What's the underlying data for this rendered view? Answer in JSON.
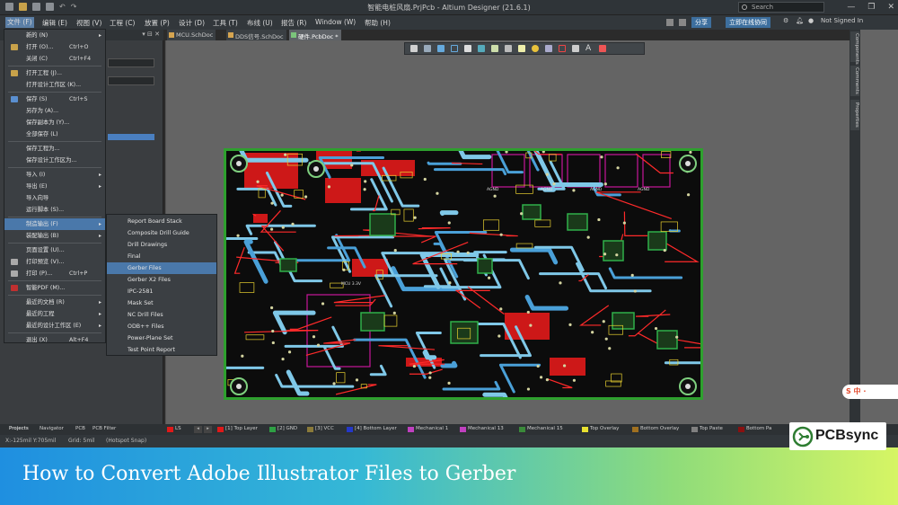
{
  "titlebar": {
    "title": "智能电桩风扇.PrjPcb - Altium Designer (21.6.1)",
    "search_placeholder": "Search",
    "win_buttons": [
      "—",
      "❐",
      "✕"
    ]
  },
  "menubar": {
    "items": [
      "文件 (F)",
      "编辑 (E)",
      "视图 (V)",
      "工程 (C)",
      "放置 (P)",
      "设计 (D)",
      "工具 (T)",
      "布线 (U)",
      "报告 (R)",
      "Window (W)",
      "帮助 (H)"
    ],
    "share_label": "分享",
    "online_label": "立即在线协同",
    "signed_label": "Not Signed In"
  },
  "doc_tabs": [
    "MCU.SchDoc",
    "DDS信号.SchDoc",
    "硬件.PcbDoc *"
  ],
  "file_menu": {
    "items": [
      {
        "label": "新的 (N)",
        "shortcut": "",
        "arrow": "▸"
      },
      {
        "label": "打开 (O)...",
        "shortcut": "Ctrl+O",
        "arrow": ""
      },
      {
        "label": "关闭 (C)",
        "shortcut": "Ctrl+F4",
        "arrow": ""
      },
      {
        "label": "打开工程 (J)...",
        "shortcut": "",
        "arrow": ""
      },
      {
        "label": "打开设计工作区 (K)...",
        "shortcut": "",
        "arrow": ""
      },
      {
        "label": "保存 (S)",
        "shortcut": "Ctrl+S",
        "arrow": ""
      },
      {
        "label": "另存为 (A)...",
        "shortcut": "",
        "arrow": ""
      },
      {
        "label": "保存副本为 (Y)...",
        "shortcut": "",
        "arrow": ""
      },
      {
        "label": "全部保存 (L)",
        "shortcut": "",
        "arrow": ""
      },
      {
        "label": "保存工程为...",
        "shortcut": "",
        "arrow": ""
      },
      {
        "label": "保存设计工作区为...",
        "shortcut": "",
        "arrow": ""
      },
      {
        "label": "导入 (I)",
        "shortcut": "",
        "arrow": "▸"
      },
      {
        "label": "导出 (E)",
        "shortcut": "",
        "arrow": "▸"
      },
      {
        "label": "导入向导",
        "shortcut": "",
        "arrow": ""
      },
      {
        "label": "运行脚本 (S)...",
        "shortcut": "",
        "arrow": ""
      },
      {
        "label": "制造输出 (F)",
        "shortcut": "",
        "arrow": "▸"
      },
      {
        "label": "装配输出 (B)",
        "shortcut": "",
        "arrow": "▸"
      },
      {
        "label": "页面设置 (U)...",
        "shortcut": "",
        "arrow": ""
      },
      {
        "label": "打印预览 (V)...",
        "shortcut": "",
        "arrow": ""
      },
      {
        "label": "打印 (P)...",
        "shortcut": "Ctrl+P",
        "arrow": ""
      },
      {
        "label": "智能PDF (M)...",
        "shortcut": "",
        "arrow": ""
      },
      {
        "label": "最近的文档 (R)",
        "shortcut": "",
        "arrow": "▸"
      },
      {
        "label": "最近的工程",
        "shortcut": "",
        "arrow": "▸"
      },
      {
        "label": "最近的设计工作区 (E)",
        "shortcut": "",
        "arrow": "▸"
      },
      {
        "label": "退出 (X)",
        "shortcut": "Alt+F4",
        "arrow": ""
      }
    ]
  },
  "fab_submenu": {
    "items": [
      "Report Board Stack",
      "Composite Drill Guide",
      "Drill Drawings",
      "Final",
      "Gerber Files",
      "Gerber X2 Files",
      "IPC-2581",
      "Mask Set",
      "NC Drill Files",
      "ODB++ Files",
      "Power-Plane Set",
      "Test Point Report"
    ],
    "highlighted": "Gerber Files"
  },
  "right_panels": [
    "Components",
    "Comments",
    "Properties"
  ],
  "pcb": {
    "net_labels": [
      "AGND",
      "AGND",
      "AGND",
      "AGND",
      "MCU 3.3V"
    ]
  },
  "panel_tabs": [
    "Projects",
    "Navigator",
    "PCB",
    "PCB Filter"
  ],
  "layers": [
    {
      "name": "LS",
      "color": "#e01818"
    },
    {
      "name": "[1] Top Layer",
      "color": "#e01818"
    },
    {
      "name": "[2] GND",
      "color": "#2ea044"
    },
    {
      "name": "[3] VCC",
      "color": "#8a7a3a"
    },
    {
      "name": "[4] Bottom Layer",
      "color": "#2438c8"
    },
    {
      "name": "Mechanical 1",
      "color": "#c040c0"
    },
    {
      "name": "Mechanical 13",
      "color": "#c040c0"
    },
    {
      "name": "Mechanical 15",
      "color": "#3a8a3a"
    },
    {
      "name": "Top Overlay",
      "color": "#e8e030"
    },
    {
      "name": "Bottom Overlay",
      "color": "#a07020"
    },
    {
      "name": "Top Paste",
      "color": "#808080"
    },
    {
      "name": "Bottom Pa",
      "color": "#8a1010"
    }
  ],
  "status": {
    "coords": "X:-125mil Y:705mil",
    "grid": "Grid: 5mil",
    "snap": "(Hotspot Snap)"
  },
  "banner": {
    "caption": "How to Convert Adobe Illustrator Files to Gerber"
  },
  "logo": {
    "brand": "PCBsync"
  },
  "ime_chip": "S 中 ·"
}
